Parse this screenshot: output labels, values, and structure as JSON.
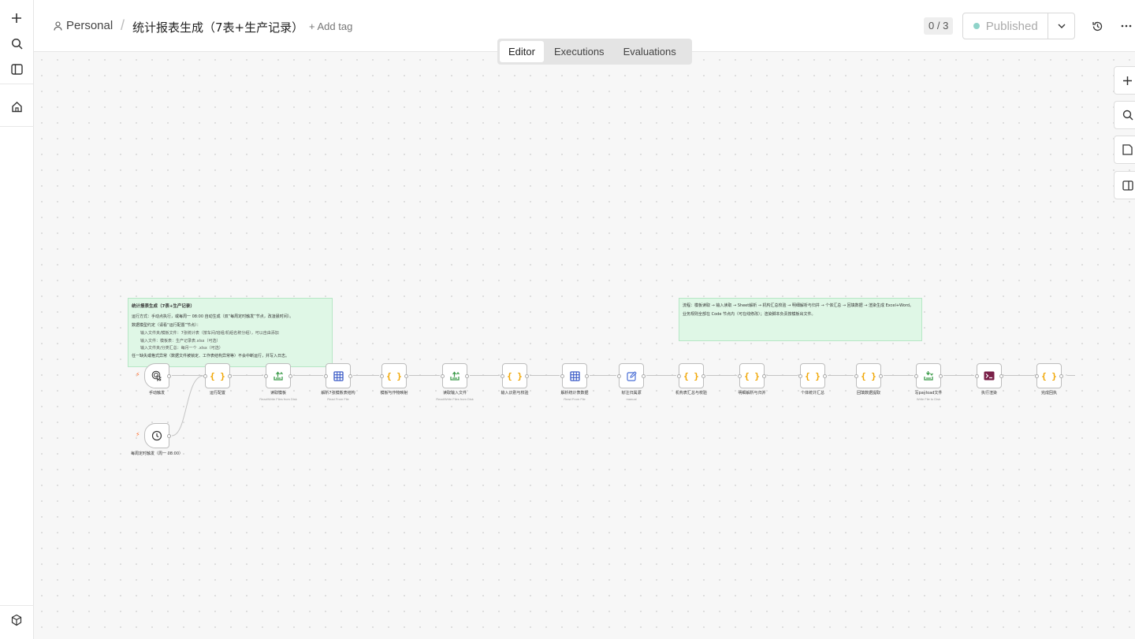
{
  "header": {
    "project": "Personal",
    "workflow_title": "统计报表生成（7表+生产记录）",
    "add_tag": "+ Add tag",
    "counter": "0 / 3",
    "publish_label": "Published"
  },
  "tabs": [
    "Editor",
    "Executions",
    "Evaluations"
  ],
  "sticky_left": {
    "title": "统计报表生成（7表+生产记录）",
    "line1": "运行方式：手动点执行，或每周一 08:00 自动生成（双“每周定时触发”节点，改凌晨时间）。",
    "line2": "数据模型约定（请看“运行配置”节点）：",
    "indent1": "输入文件夹/模板文件：7张统计表（按车间/班组/机组名称分组），可以自由添加",
    "indent2": "输入文件：模板表：生产记录表.xlsx（可选）",
    "indent3": "输入文件夹/分类汇总：每月一个 .xlsx（可选）",
    "line3": "任一缺失或格式异常（数据文件被锁定、工作表结构异常等）不会中断运行，并写入日志。"
  },
  "sticky_right": {
    "line1": "流程：模板读取 → 输入读取 → Sheet解析 → 机构汇总校验 → 明细解析与归并 → 个体汇总 → 回填数据 → 渲染生成 Excel+Word。",
    "line2": "业务规则全部在 Code 节点内（可在线修改）；渲染脚本负责按模板出文件。"
  },
  "nodes": [
    {
      "label": "手动触发",
      "sub": ""
    },
    {
      "label": "运行配置",
      "sub": ""
    },
    {
      "label": "读取模板",
      "sub": "Read/Write Files from Disk"
    },
    {
      "label": "解析7张模板表结构",
      "sub": "Read From File"
    },
    {
      "label": "模板与作物映射",
      "sub": ""
    },
    {
      "label": "读取输入文件",
      "sub": "Read/Write Files from Disk"
    },
    {
      "label": "输入识别与校验",
      "sub": ""
    },
    {
      "label": "解析统计表数据",
      "sub": "Read From File"
    },
    {
      "label": "标注归属源",
      "sub": "manual"
    },
    {
      "label": "机构表汇总与校验",
      "sub": ""
    },
    {
      "label": "明细解析与归并",
      "sub": ""
    },
    {
      "label": "个体统计汇总",
      "sub": ""
    },
    {
      "label": "回填数据提取",
      "sub": ""
    },
    {
      "label": "写payload文件",
      "sub": "Write File to Disk"
    },
    {
      "label": "执行渲染",
      "sub": ""
    },
    {
      "label": "完成回执",
      "sub": ""
    }
  ],
  "schedule_node": {
    "label": "每周定时触发（周一 08:00）"
  },
  "colors": {
    "code_orange": "#f0a500",
    "file_green": "#3c9b4a",
    "table_blue": "#3a5bc7",
    "edit_blue": "#4a6fd6",
    "exec_purple": "#7a2048",
    "sticky_bg": "#dff7e6",
    "bolt": "#ff6d2d"
  }
}
